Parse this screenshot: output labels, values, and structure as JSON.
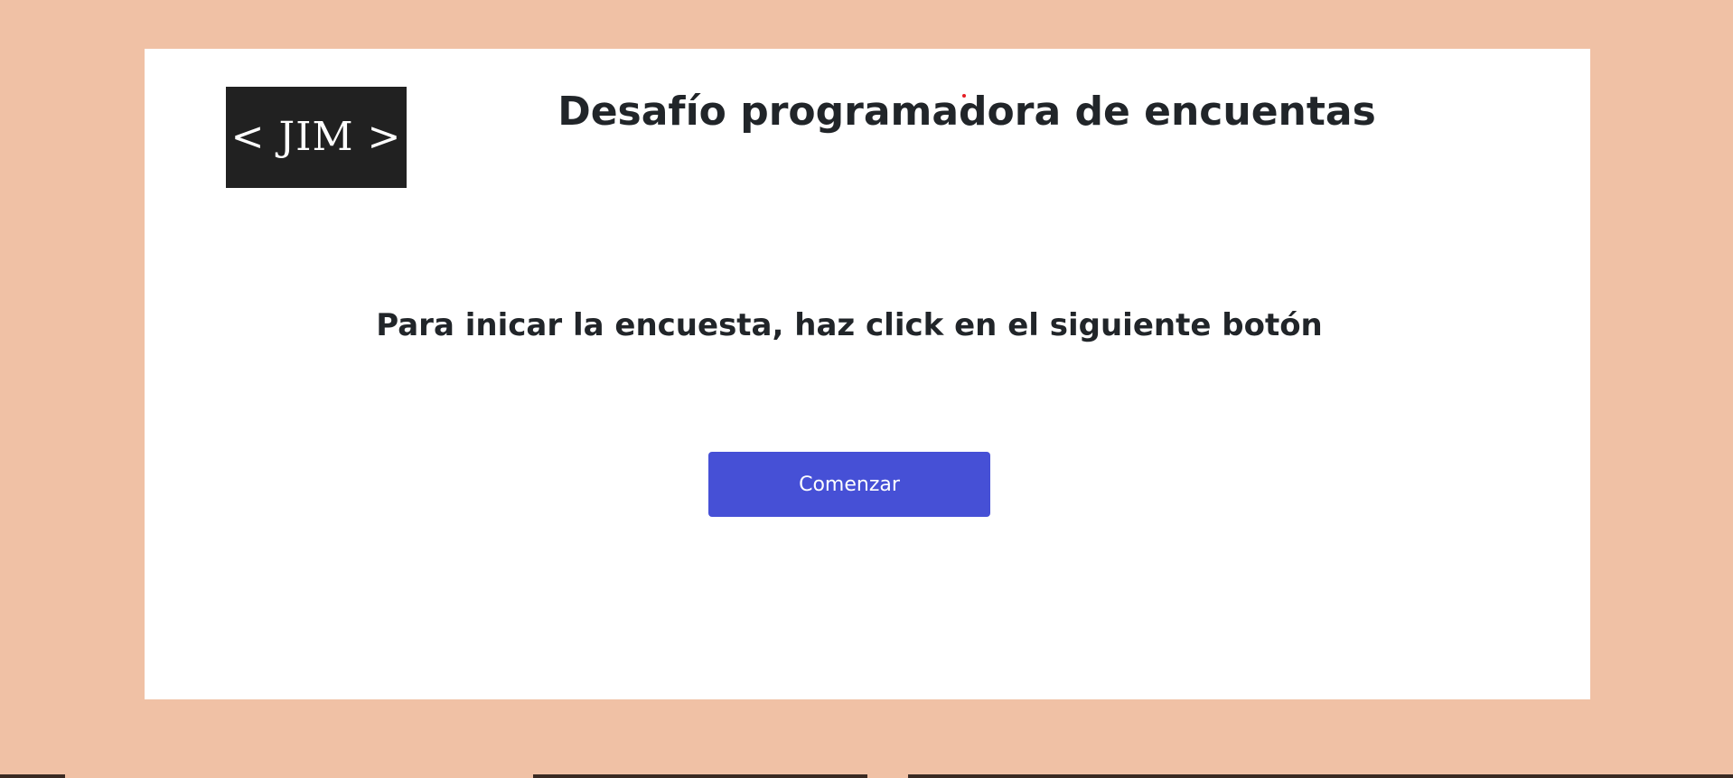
{
  "logo": {
    "text": "< JIM >"
  },
  "header": {
    "title": "Desafío programadora de encuentas"
  },
  "main": {
    "instruction": "Para inicar la encuesta, haz click en el siguiente botón",
    "start_button_label": "Comenzar"
  },
  "colors": {
    "page_background": "#f0c1a5",
    "card_background": "#ffffff",
    "logo_background": "#212121",
    "button_background": "#4650d6",
    "text": "#212529"
  }
}
